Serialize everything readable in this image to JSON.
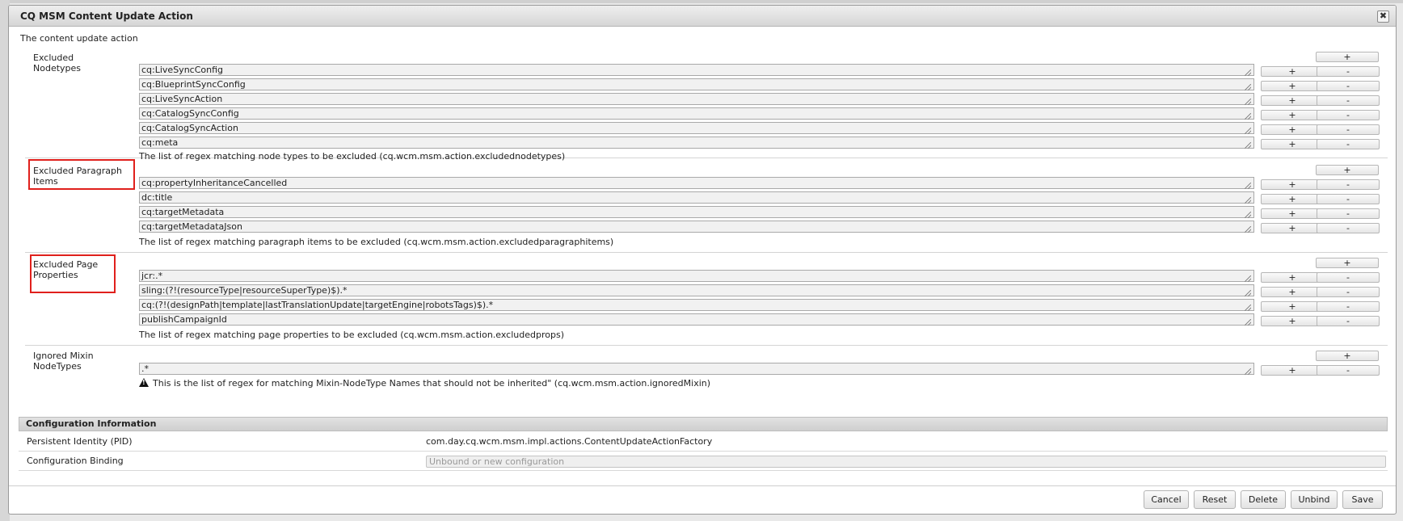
{
  "dialog": {
    "title": "CQ MSM Content Update Action",
    "close_glyph": "✖",
    "description": "The content update action"
  },
  "plus_label": "+",
  "minus_label": "-",
  "sections": {
    "excluded_nodetypes": {
      "label": "Excluded Nodetypes",
      "values": [
        "cq:LiveSyncConfig",
        "cq:BlueprintSyncConfig",
        "cq:LiveSyncAction",
        "cq:CatalogSyncConfig",
        "cq:CatalogSyncAction",
        "cq:meta"
      ],
      "help": "The list of regex matching node types to be excluded (cq.wcm.msm.action.excludednodetypes)"
    },
    "excluded_paragraph_items": {
      "label": "Excluded Paragraph Items",
      "values": [
        "cq:propertyInheritanceCancelled",
        "dc:title",
        "cq:targetMetadata",
        "cq:targetMetadataJson"
      ],
      "help": "The list of regex matching paragraph items to be excluded (cq.wcm.msm.action.excludedparagraphitems)"
    },
    "excluded_page_properties": {
      "label": "Excluded Page Properties",
      "values": [
        "jcr:.*",
        "sling:(?!(resourceType|resourceSuperType)$).*",
        "cq:(?!(designPath|template|lastTranslationUpdate|targetEngine|robotsTags)$).*",
        "publishCampaignId"
      ],
      "help": "The list of regex matching page properties to be excluded (cq.wcm.msm.action.excludedprops)"
    },
    "ignored_mixin_nodetypes": {
      "label": "Ignored Mixin NodeTypes",
      "values": [
        ".*"
      ],
      "help": "This is the list of regex for matching Mixin-NodeType Names that should not be inherited\" (cq.wcm.msm.action.ignoredMixin)"
    }
  },
  "config_info": {
    "header": "Configuration Information",
    "pid_label": "Persistent Identity (PID)",
    "pid_value": "com.day.cq.wcm.msm.impl.actions.ContentUpdateActionFactory",
    "binding_label": "Configuration Binding",
    "binding_placeholder": "Unbound or new configuration"
  },
  "footer": {
    "cancel": "Cancel",
    "reset": "Reset",
    "delete": "Delete",
    "unbind": "Unbind",
    "save": "Save"
  },
  "colors": {
    "highlight": "#e0201c",
    "header_bg": "#d6d6d6"
  }
}
